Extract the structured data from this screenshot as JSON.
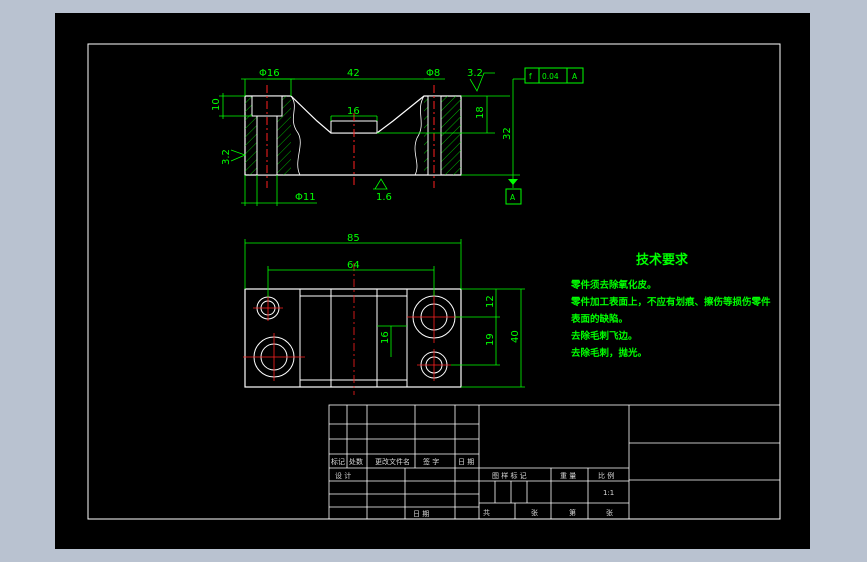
{
  "front_view": {
    "dims": {
      "hole_top_dia": "Φ16",
      "span_top": "42",
      "hole_right_dia": "Φ8",
      "roughness_top": "3.2",
      "height_left": "10",
      "slot_width": "16",
      "step_height": "18",
      "total_height": "32",
      "roughness_left": "3.2",
      "roughness_bottom": "1.6",
      "hole_bottom_dia": "Φ11"
    },
    "tolerance_frame": {
      "symbol": "f",
      "value": "0.04",
      "datum": "A"
    },
    "datum_label": "A"
  },
  "top_view": {
    "dims": {
      "overall_length": "85",
      "hole_spacing": "64",
      "offset_right": "12",
      "slot": "16",
      "hole_offset": "19",
      "overall_width": "40"
    }
  },
  "technical_requirements": {
    "title": "技术要求",
    "lines": [
      "零件须去除氧化皮。",
      "零件加工表面上，不应有划痕、擦伤等损伤零件",
      "表面的缺陷。",
      "去除毛刺飞边。",
      "去除毛刺，抛光。"
    ]
  },
  "title_block": {
    "headers_left": [
      "标记",
      "处数",
      "更改文件名",
      "签 字",
      "日 期"
    ],
    "designer": "设 计",
    "date_label": "日 期",
    "headers_mid": [
      "图 样 标 记",
      "重 量",
      "比 例"
    ],
    "scale": "1:1",
    "sheet_info": [
      "共",
      "张",
      "第",
      "张"
    ]
  }
}
